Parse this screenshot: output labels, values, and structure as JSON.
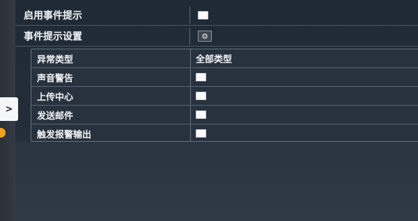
{
  "settings": {
    "enable_event_hint": {
      "label": "启用事件提示",
      "checked": false
    },
    "event_hint_settings": {
      "label": "事件提示设置",
      "icon": "gear-icon"
    }
  },
  "panel": {
    "exception_type": {
      "label": "异常类型",
      "value": "全部类型"
    },
    "rows": [
      {
        "label": "声音警告",
        "checked": false
      },
      {
        "label": "上传中心",
        "checked": false
      },
      {
        "label": "发送邮件",
        "checked": false
      },
      {
        "label": "触发报警输出",
        "checked": false
      }
    ]
  },
  "side": {
    "expand_label": ">"
  }
}
